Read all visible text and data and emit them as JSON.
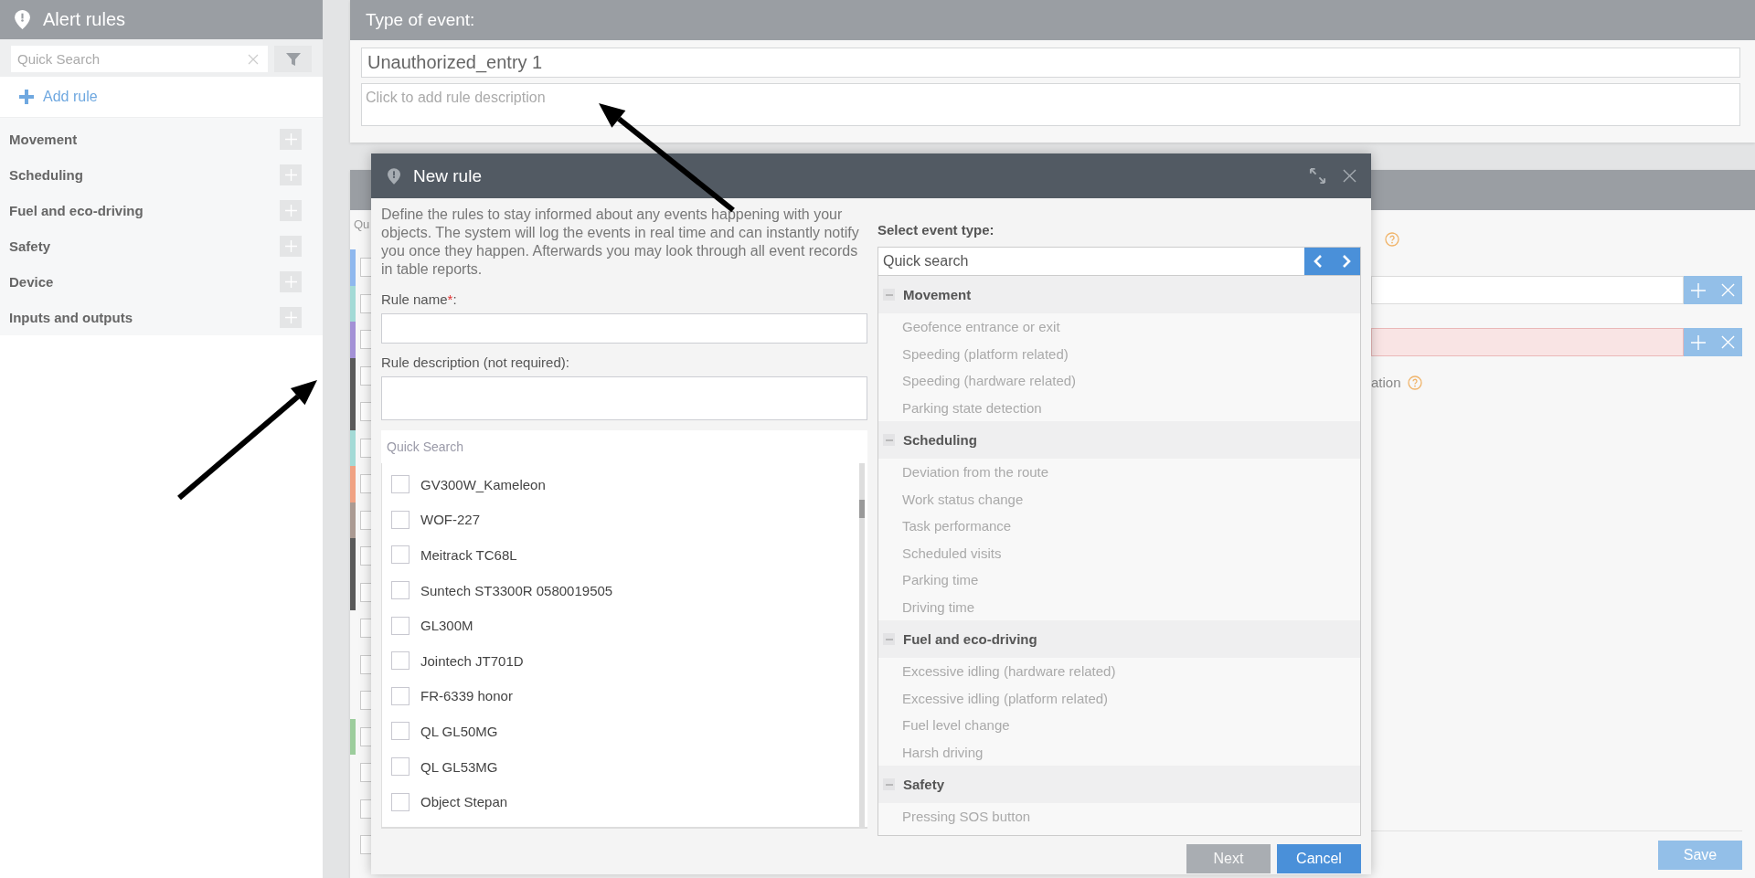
{
  "sidebar": {
    "title": "Alert rules",
    "search": {
      "placeholder": "Quick Search"
    },
    "add_rule": "Add rule",
    "categories": [
      {
        "name": "Movement"
      },
      {
        "name": "Scheduling"
      },
      {
        "name": "Fuel and eco-driving"
      },
      {
        "name": "Safety"
      },
      {
        "name": "Device"
      },
      {
        "name": "Inputs and outputs"
      }
    ]
  },
  "event_card": {
    "title": "Type of event:",
    "name_value": "Unauthorized_entry 1",
    "description_placeholder": "Click to add rule description"
  },
  "rules_panel": {
    "search_text": "Qu",
    "rows": [
      {
        "checked": false,
        "color": "#8fb8ee"
      },
      {
        "checked": false,
        "color": "#a3dad6"
      },
      {
        "checked": false,
        "color": "#a391d6"
      },
      {
        "checked": false,
        "color": "#5a5a5a"
      },
      {
        "checked": false,
        "color": "#5a5a5a"
      },
      {
        "checked": false,
        "color": "#a3dad6"
      },
      {
        "checked": false,
        "color": "#f0a283"
      },
      {
        "checked": false,
        "color": "#ab9a92"
      },
      {
        "checked": false,
        "color": "#5a5a5a"
      },
      {
        "checked": false,
        "color": "#5a5a5a"
      },
      {
        "checked": false
      },
      {
        "checked": false
      },
      {
        "checked": false
      },
      {
        "checked": false,
        "color": "#9ccd9c"
      },
      {
        "checked": false
      },
      {
        "checked": false
      },
      {
        "checked": false
      }
    ],
    "fields": [
      {
        "invalid": false
      },
      {
        "invalid": true
      }
    ],
    "option_text": "ation",
    "save": "Save"
  },
  "dialog": {
    "title": "New rule",
    "intro": "Define the rules to stay informed about any events happening with your objects. The system will log the events in real time and can instantly notify you once they happen. Afterwards you may look through all event records in table reports.",
    "rule_name": {
      "label": "Rule name",
      "required_mark": "*",
      "label_end": ":"
    },
    "rule_description": {
      "label": "Rule description (not required):"
    },
    "objects": {
      "search_placeholder": "Quick Search",
      "items": [
        {
          "name": "GV300W_Kameleon",
          "checked": false
        },
        {
          "name": "WOF-227",
          "checked": false
        },
        {
          "name": "Meitrack TC68L",
          "checked": false
        },
        {
          "name": "Suntech ST3300R 0580019505",
          "checked": false
        },
        {
          "name": "GL300M",
          "checked": false
        },
        {
          "name": "Jointech JT701D",
          "checked": false
        },
        {
          "name": "FR-6339 honor",
          "checked": false
        },
        {
          "name": "QL GL50MG",
          "checked": false
        },
        {
          "name": "QL GL53MG",
          "checked": false
        },
        {
          "name": "Object Stepan",
          "checked": false
        }
      ]
    },
    "event_type": {
      "label": "Select event type:",
      "search_placeholder": "Quick search",
      "groups": [
        {
          "name": "Movement",
          "expanded": true,
          "items": [
            "Geofence entrance or exit",
            "Speeding (platform related)",
            "Speeding (hardware related)",
            "Parking state detection"
          ]
        },
        {
          "name": "Scheduling",
          "expanded": true,
          "items": [
            "Deviation from the route",
            "Work status change",
            "Task performance",
            "Scheduled visits",
            "Parking time",
            "Driving time"
          ]
        },
        {
          "name": "Fuel and eco-driving",
          "expanded": true,
          "items": [
            "Excessive idling (hardware related)",
            "Excessive idling (platform related)",
            "Fuel level change",
            "Harsh driving"
          ]
        },
        {
          "name": "Safety",
          "expanded": true,
          "items": [
            "Pressing SOS button"
          ]
        }
      ]
    },
    "buttons": [
      {
        "label": "Next",
        "disabled": true
      },
      {
        "label": "Cancel",
        "disabled": false
      }
    ]
  }
}
